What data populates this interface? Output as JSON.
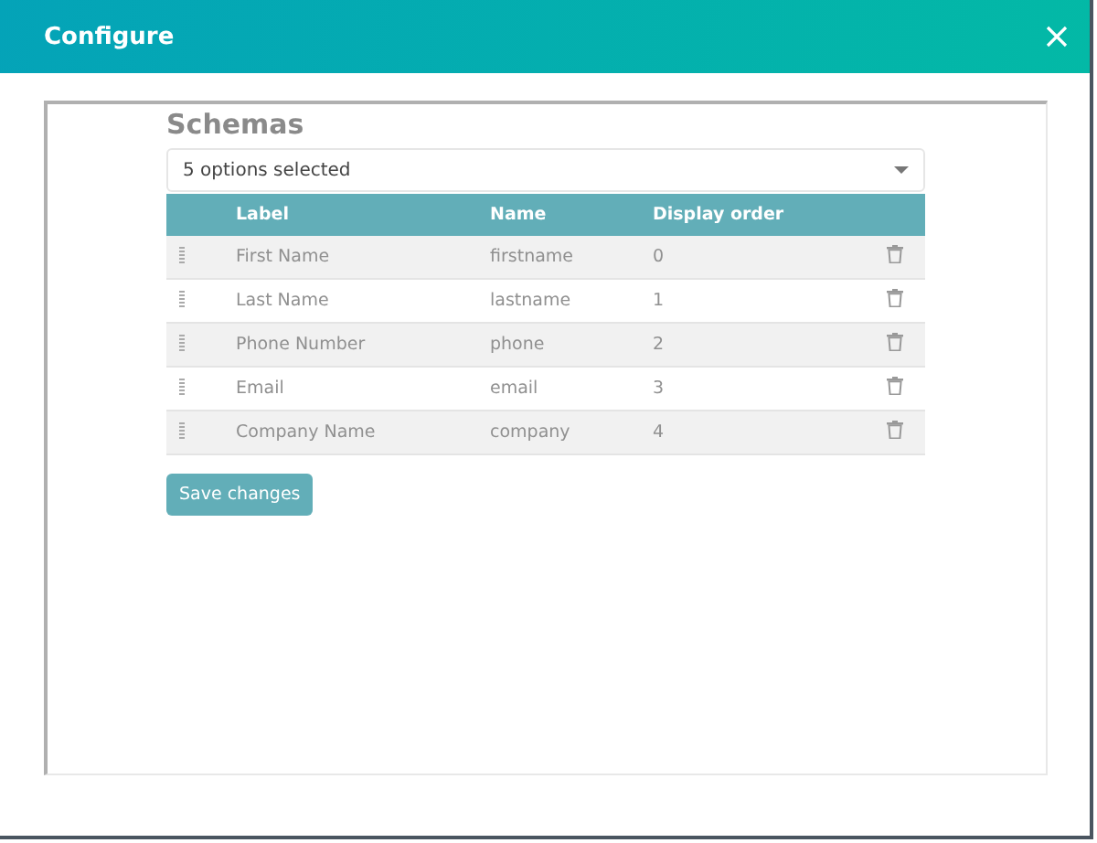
{
  "dialog": {
    "title": "Configure"
  },
  "section": {
    "title": "Schemas",
    "select": {
      "value": "5 options selected"
    }
  },
  "table": {
    "columns": [
      "Label",
      "Name",
      "Display order"
    ],
    "rows": [
      {
        "label": "First Name",
        "name": "firstname",
        "order": "0"
      },
      {
        "label": "Last Name",
        "name": "lastname",
        "order": "1"
      },
      {
        "label": "Phone Number",
        "name": "phone",
        "order": "2"
      },
      {
        "label": "Email",
        "name": "email",
        "order": "3"
      },
      {
        "label": "Company Name",
        "name": "company",
        "order": "4"
      }
    ]
  },
  "buttons": [
    "Save changes"
  ]
}
